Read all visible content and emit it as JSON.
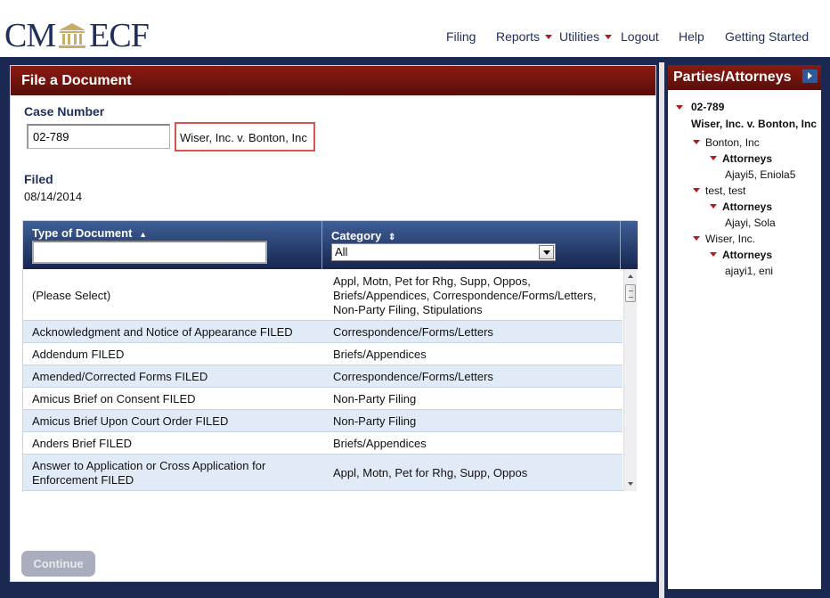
{
  "app": {
    "logo_left": "CM",
    "logo_right": "ECF"
  },
  "nav": {
    "items": [
      {
        "label": "Filing",
        "has_dropdown": false
      },
      {
        "label": "Reports",
        "has_dropdown": true
      },
      {
        "label": "Utilities",
        "has_dropdown": true
      },
      {
        "label": "Logout",
        "has_dropdown": false
      },
      {
        "label": "Help",
        "has_dropdown": false
      },
      {
        "label": "Getting Started",
        "has_dropdown": false
      }
    ]
  },
  "main": {
    "title": "File a Document",
    "case_number_label": "Case Number",
    "case_number_value": "02-789",
    "case_name": "Wiser, Inc. v. Bonton, Inc",
    "filed_label": "Filed",
    "filed_date": "08/14/2014",
    "grid": {
      "col1_header": "Type of Document",
      "col1_sort_icon": "▲",
      "col1_filter_value": "",
      "col2_header": "Category",
      "col2_sort_icon": "⇕",
      "category_selected": "All",
      "rows": [
        {
          "type": "(Please Select)",
          "category_lines": [
            "Appl, Motn, Pet for Rhg, Supp, Oppos,",
            "Briefs/Appendices, Correspondence/Forms/Letters,",
            "Non-Party Filing, Stipulations"
          ]
        },
        {
          "type": "Acknowledgment and Notice of Appearance FILED",
          "category_lines": [
            "Correspondence/Forms/Letters"
          ]
        },
        {
          "type": "Addendum FILED",
          "category_lines": [
            "Briefs/Appendices"
          ]
        },
        {
          "type": "Amended/Corrected Forms FILED",
          "category_lines": [
            "Correspondence/Forms/Letters"
          ]
        },
        {
          "type": "Amicus Brief on Consent FILED",
          "category_lines": [
            "Non-Party Filing"
          ]
        },
        {
          "type": "Amicus Brief Upon Court Order FILED",
          "category_lines": [
            "Non-Party Filing"
          ]
        },
        {
          "type": "Anders Brief FILED",
          "category_lines": [
            "Briefs/Appendices"
          ]
        },
        {
          "type_lines": [
            "Answer to Application or Cross Application for",
            "Enforcement FILED"
          ],
          "category_lines": [
            "Appl, Motn, Pet for Rhg, Supp, Oppos"
          ]
        }
      ]
    },
    "continue_label": "Continue"
  },
  "sidebar": {
    "title": "Parties/Attorneys",
    "case_number": "02-789",
    "case_name": "Wiser, Inc. v. Bonton, Inc",
    "parties": [
      {
        "name": "Bonton, Inc",
        "attorneys_label": "Attorneys",
        "attorneys": "Ajayi5, Eniola5"
      },
      {
        "name": "test, test",
        "attorneys_label": "Attorneys",
        "attorneys": "Ajayi, Sola"
      },
      {
        "name": "Wiser, Inc.",
        "attorneys_label": "Attorneys",
        "attorneys": "ajayi1, eni"
      }
    ]
  },
  "colors": {
    "navy": "#1b2852",
    "header_red": "#7a1510",
    "accent_red": "#b01c1c",
    "row_alt": "#e1ebf8",
    "highlight_box": "#d9534f"
  }
}
